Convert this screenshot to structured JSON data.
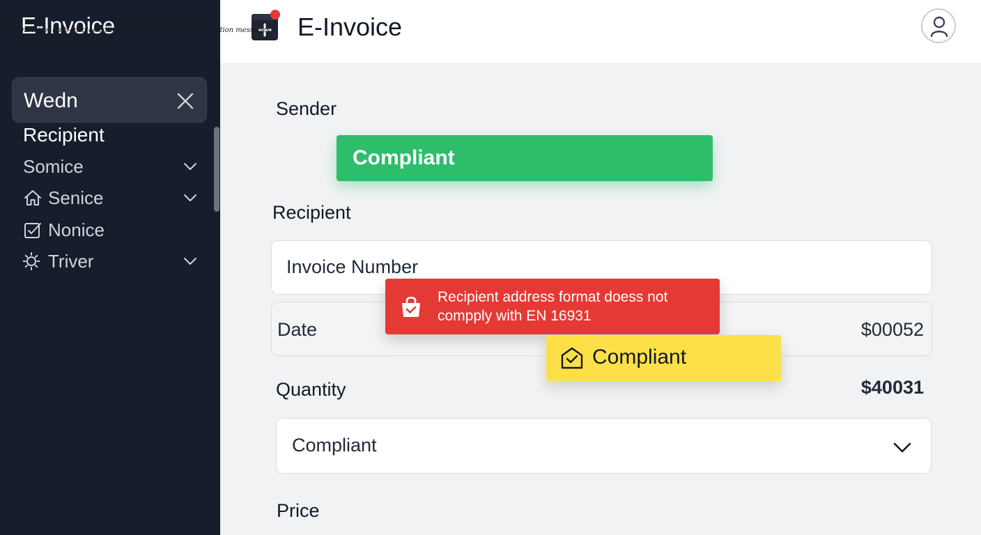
{
  "caption": "Screenshot of an E-Invoice editor UI showing real-time validation messages",
  "sidebar": {
    "title": "E-Invoice",
    "search": {
      "value": "Wedn",
      "clear_icon": "close-icon"
    },
    "heading": "Recipient",
    "items": [
      {
        "label": "Somice",
        "icon": "",
        "expandable": true
      },
      {
        "label": "Senice",
        "icon": "home-icon",
        "expandable": true
      },
      {
        "label": "Nonice",
        "icon": "checkbox-icon",
        "expandable": false
      },
      {
        "label": "Triver",
        "icon": "sun-icon",
        "expandable": true
      }
    ]
  },
  "header": {
    "title": "E-Invoice",
    "logo_icon": "invoice-add-icon",
    "avatar_icon": "user-icon"
  },
  "form": {
    "sender_label": "Sender",
    "sender_status": "Compliant",
    "recipient_label": "Recipient",
    "invoice_number_placeholder": "Invoice Number",
    "date_label": "Date",
    "date_amount": "$00052",
    "quantity_label": "Quantity",
    "quantity_amount": "$40031",
    "compliance_select_value": "Compliant",
    "price_label": "Price"
  },
  "validation": {
    "error_message": "Recipient address format doess not compply with EN 16931",
    "warning_message": "Compliant"
  },
  "colors": {
    "sidebar_bg": "#161d2b",
    "success": "#2ebd6b",
    "error": "#e53935",
    "warning": "#fde047",
    "notification_dot": "#e53935"
  }
}
